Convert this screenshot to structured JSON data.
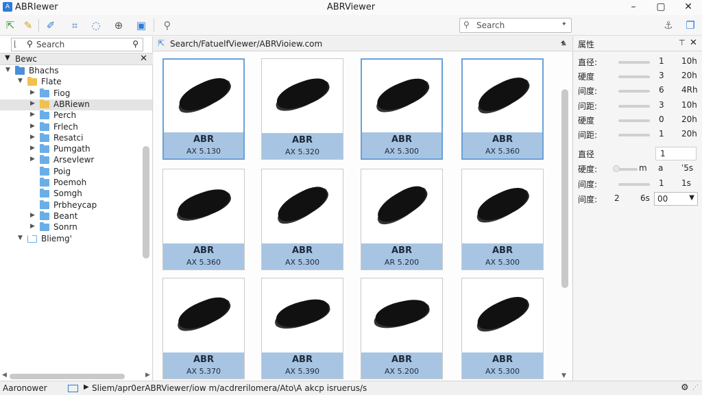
{
  "app": {
    "name": "ABRIewer",
    "title": "ABRViewer",
    "accent": "#2f7bd6"
  },
  "window_controls": {
    "minimize": "–",
    "maximize": "▢",
    "close": "✕"
  },
  "toolbar": {
    "tools": [
      "arrow-icon",
      "pencil-icon",
      "brush-icon",
      "lasso-icon",
      "bubble-icon",
      "zoom-icon",
      "calendar-icon",
      "magnifier-icon"
    ],
    "search_placeholder": "Search",
    "right_icons": [
      "pin-icon",
      "copy-icon"
    ]
  },
  "left_panel": {
    "search_placeholder": "Search",
    "header": "Bewc",
    "tree": [
      {
        "label": "Bhachs",
        "level": 0,
        "expanded": true,
        "color": "#4a90d9"
      },
      {
        "label": "Flate",
        "level": 1,
        "expanded": true,
        "color": "#f0c24b"
      },
      {
        "label": "Fiog",
        "level": 2,
        "expanded": false,
        "color": "#6aaee8"
      },
      {
        "label": "ABRiewn",
        "level": 2,
        "expanded": false,
        "color": "#f0c24b",
        "selected": true
      },
      {
        "label": "Perch",
        "level": 2,
        "expanded": false,
        "color": "#6aaee8"
      },
      {
        "label": "Frlech",
        "level": 2,
        "expanded": false,
        "color": "#6aaee8"
      },
      {
        "label": "Resatci",
        "level": 2,
        "expanded": false,
        "color": "#6aaee8"
      },
      {
        "label": "Pumgath",
        "level": 2,
        "expanded": false,
        "color": "#6aaee8"
      },
      {
        "label": "Arsevlewr",
        "level": 2,
        "expanded": false,
        "color": "#6aaee8"
      },
      {
        "label": "Poig",
        "level": 2,
        "leaf": true,
        "color": "#6aaee8"
      },
      {
        "label": "Poemoh",
        "level": 2,
        "leaf": true,
        "color": "#6aaee8"
      },
      {
        "label": "Somgh",
        "level": 2,
        "leaf": true,
        "color": "#6aaee8"
      },
      {
        "label": "Prbheycap",
        "level": 2,
        "leaf": true,
        "color": "#6aaee8"
      },
      {
        "label": "Beant",
        "level": 2,
        "expanded": false,
        "color": "#6aaee8"
      },
      {
        "label": "Sonrn",
        "level": 2,
        "expanded": false,
        "color": "#6aaee8"
      },
      {
        "label": "Bliemg'",
        "level": 1,
        "expanded": true,
        "color": "#6aaee8",
        "outlined": true
      }
    ]
  },
  "center": {
    "path": "Search/FatuelfViewer/ABRVioiew.com",
    "cards": [
      {
        "name": "ABR",
        "size": "AX 5.130",
        "selected": true
      },
      {
        "name": "ABR",
        "size": "AX 5.320",
        "selected": false
      },
      {
        "name": "ABR",
        "size": "AX 5.300",
        "selected": true
      },
      {
        "name": "ABR",
        "size": "AX 5.360",
        "selected": true
      },
      {
        "name": "ABR",
        "size": "AX 5.360",
        "selected": false
      },
      {
        "name": "ABR",
        "size": "AX 5.300",
        "selected": false
      },
      {
        "name": "ABR",
        "size": "AR 5.200",
        "selected": false
      },
      {
        "name": "ABR",
        "size": "AX 5.300",
        "selected": false
      },
      {
        "name": "ABR",
        "size": "AX 5.370",
        "selected": false
      },
      {
        "name": "ABR",
        "size": "AX 5.390",
        "selected": false
      },
      {
        "name": "ABR",
        "size": "AX 5.200",
        "selected": false
      },
      {
        "name": "ABR",
        "size": "AX 5.300",
        "selected": false
      }
    ]
  },
  "properties": {
    "header": "属性",
    "rows": [
      {
        "label": "直径:",
        "value": "1",
        "unit": "10h"
      },
      {
        "label": "硬度",
        "value": "3",
        "unit": "20h"
      },
      {
        "label": "间度:",
        "value": "6",
        "unit": "4Rh"
      },
      {
        "label": "问距:",
        "value": "3",
        "unit": "10h"
      },
      {
        "label": "硬度",
        "value": "0",
        "unit": "20h"
      },
      {
        "label": "间距:",
        "value": "1",
        "unit": "20h"
      }
    ],
    "diameter": {
      "label": "直径",
      "value": "1"
    },
    "hardness": {
      "label": "硬度:",
      "unit": "m",
      "value": "a",
      "extra": "ˈ5s"
    },
    "spacing": {
      "label": "间度:",
      "value": "1",
      "unit": "1s"
    },
    "spacing2": {
      "label": "间度:",
      "value": "2",
      "unit": "6s",
      "select": "00"
    }
  },
  "statusbar": {
    "app": "Aaronower",
    "path": "Sliem/apr0erABRViewer/iow m/acdrerilomera/Ato\\A akcp isruerus/s"
  }
}
